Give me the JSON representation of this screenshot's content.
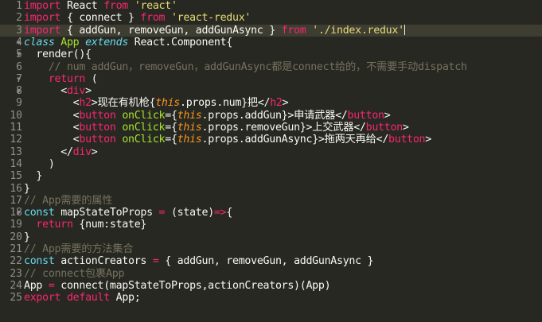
{
  "editor": {
    "current_line": 3,
    "lines": [
      {
        "n": "1",
        "fold": "",
        "tokens": [
          [
            "kw",
            "import"
          ],
          [
            "def",
            " React "
          ],
          [
            "kw",
            "from"
          ],
          [
            "def",
            " "
          ],
          [
            "str",
            "'react'"
          ]
        ]
      },
      {
        "n": "2",
        "fold": "",
        "tokens": [
          [
            "kw",
            "import"
          ],
          [
            "def",
            " { connect } "
          ],
          [
            "kw",
            "from"
          ],
          [
            "def",
            " "
          ],
          [
            "str",
            "'react-redux'"
          ]
        ]
      },
      {
        "n": "3",
        "fold": "",
        "cursor": true,
        "tokens": [
          [
            "kw",
            "import"
          ],
          [
            "def",
            " { addGun, removeGun, addGunAsync } "
          ],
          [
            "kw",
            "from"
          ],
          [
            "def",
            " "
          ],
          [
            "str",
            "'./index.redux'"
          ]
        ]
      },
      {
        "n": "4",
        "fold": "▼",
        "tokens": [
          [
            "sto",
            "class"
          ],
          [
            "def",
            " "
          ],
          [
            "cls",
            "App"
          ],
          [
            "def",
            " "
          ],
          [
            "sto",
            "extends"
          ],
          [
            "def",
            " React.Component{"
          ]
        ]
      },
      {
        "n": "5",
        "fold": "▼",
        "tokens": [
          [
            "def",
            "  render(){"
          ]
        ]
      },
      {
        "n": "6",
        "fold": "",
        "tokens": [
          [
            "com",
            "    // num addGun，removeGun，addGunAsync都是connect给的，不需要手动dispatch"
          ]
        ]
      },
      {
        "n": "7",
        "fold": "▼",
        "tokens": [
          [
            "def",
            "    "
          ],
          [
            "kw",
            "return"
          ],
          [
            "def",
            " ("
          ]
        ]
      },
      {
        "n": "8",
        "fold": "▼",
        "tokens": [
          [
            "def",
            "      <"
          ],
          [
            "tag",
            "div"
          ],
          [
            "def",
            ">"
          ]
        ]
      },
      {
        "n": "9",
        "fold": "",
        "tokens": [
          [
            "def",
            "        <"
          ],
          [
            "tag",
            "h2"
          ],
          [
            "def",
            ">现在有机枪{"
          ],
          [
            "this",
            "this"
          ],
          [
            "def",
            ".props.num}把</"
          ],
          [
            "tag",
            "h2"
          ],
          [
            "def",
            ">"
          ]
        ]
      },
      {
        "n": "10",
        "fold": "",
        "tokens": [
          [
            "def",
            "        <"
          ],
          [
            "tag",
            "button"
          ],
          [
            "def",
            " "
          ],
          [
            "attr",
            "onClick"
          ],
          [
            "def",
            "={"
          ],
          [
            "this",
            "this"
          ],
          [
            "def",
            ".props.addGun}>申请武器</"
          ],
          [
            "tag",
            "button"
          ],
          [
            "def",
            ">"
          ]
        ]
      },
      {
        "n": "11",
        "fold": "",
        "tokens": [
          [
            "def",
            "        <"
          ],
          [
            "tag",
            "button"
          ],
          [
            "def",
            " "
          ],
          [
            "attr",
            "onClick"
          ],
          [
            "def",
            "={"
          ],
          [
            "this",
            "this"
          ],
          [
            "def",
            ".props.removeGun}>上交武器</"
          ],
          [
            "tag",
            "button"
          ],
          [
            "def",
            ">"
          ]
        ]
      },
      {
        "n": "12",
        "fold": "",
        "tokens": [
          [
            "def",
            "        <"
          ],
          [
            "tag",
            "button"
          ],
          [
            "def",
            " "
          ],
          [
            "attr",
            "onClick"
          ],
          [
            "def",
            "={"
          ],
          [
            "this",
            "this"
          ],
          [
            "def",
            ".props.addGunAsync}>拖两天再给</"
          ],
          [
            "tag",
            "button"
          ],
          [
            "def",
            ">"
          ]
        ]
      },
      {
        "n": "13",
        "fold": "",
        "tokens": [
          [
            "def",
            "      </"
          ],
          [
            "tag",
            "div"
          ],
          [
            "def",
            ">"
          ]
        ]
      },
      {
        "n": "14",
        "fold": "",
        "tokens": [
          [
            "def",
            "    )"
          ]
        ]
      },
      {
        "n": "15",
        "fold": "",
        "tokens": [
          [
            "def",
            "  }"
          ]
        ]
      },
      {
        "n": "16",
        "fold": "",
        "tokens": [
          [
            "def",
            "}"
          ]
        ]
      },
      {
        "n": "17",
        "fold": "",
        "tokens": [
          [
            "com",
            "// App需要的属性"
          ]
        ]
      },
      {
        "n": "18",
        "fold": "▼",
        "tokens": [
          [
            "type",
            "const"
          ],
          [
            "def",
            " mapStateToProps "
          ],
          [
            "op",
            "="
          ],
          [
            "def",
            " (state)"
          ],
          [
            "op",
            "=>"
          ],
          [
            "def",
            "{"
          ]
        ]
      },
      {
        "n": "19",
        "fold": "",
        "tokens": [
          [
            "def",
            "  "
          ],
          [
            "kw",
            "return"
          ],
          [
            "def",
            " {num:state}"
          ]
        ]
      },
      {
        "n": "20",
        "fold": "",
        "tokens": [
          [
            "def",
            "}"
          ]
        ]
      },
      {
        "n": "21",
        "fold": "",
        "tokens": [
          [
            "com",
            "// App需要的方法集合"
          ]
        ]
      },
      {
        "n": "22",
        "fold": "",
        "tokens": [
          [
            "type",
            "const"
          ],
          [
            "def",
            " actionCreators "
          ],
          [
            "op",
            "="
          ],
          [
            "def",
            " { addGun, removeGun, addGunAsync }"
          ]
        ]
      },
      {
        "n": "23",
        "fold": "",
        "tokens": [
          [
            "com",
            "// connect包裹App"
          ]
        ]
      },
      {
        "n": "24",
        "fold": "",
        "tokens": [
          [
            "def",
            "App "
          ],
          [
            "op",
            "="
          ],
          [
            "def",
            " connect(mapStateToProps,actionCreators)(App)"
          ]
        ]
      },
      {
        "n": "25",
        "fold": "",
        "tokens": [
          [
            "kw",
            "export"
          ],
          [
            "def",
            " "
          ],
          [
            "kw",
            "default"
          ],
          [
            "def",
            " App;"
          ]
        ]
      }
    ]
  },
  "colors": {
    "background": "#272822",
    "current_line": "#3e3d32",
    "gutter_text": "#8f908a",
    "keyword": "#f92672",
    "string": "#e6db74",
    "comment": "#75715e",
    "class_name": "#a6e22e",
    "storage": "#66d9ef",
    "this": "#fd971f"
  }
}
